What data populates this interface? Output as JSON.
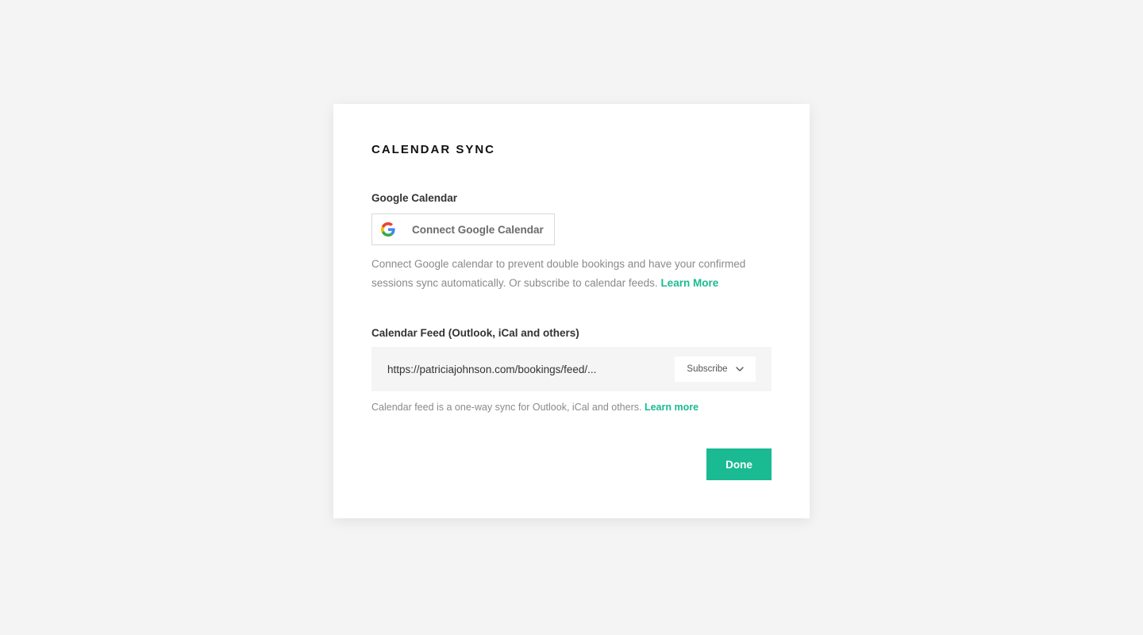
{
  "modal": {
    "title": "CALENDAR SYNC"
  },
  "google": {
    "section_label": "Google Calendar",
    "button_label": "Connect Google Calendar",
    "icon": "google-g-icon",
    "description": "Connect Google calendar to prevent double bookings and have your confirmed sessions sync automatically. Or subscribe to calendar feeds.",
    "learn_more_label": "Learn More"
  },
  "feed": {
    "section_label": "Calendar Feed (Outlook, iCal and others)",
    "url": "https://patriciajohnson.com/bookings/feed/...",
    "subscribe_label": "Subscribe",
    "subscribe_icon": "chevron-down-icon",
    "description": "Calendar feed is a one-way sync for Outlook, iCal and others.",
    "learn_more_label": "Learn more"
  },
  "actions": {
    "done_label": "Done"
  },
  "colors": {
    "accent": "#1aba92",
    "background": "#f4f4f4",
    "modal": "#ffffff"
  }
}
